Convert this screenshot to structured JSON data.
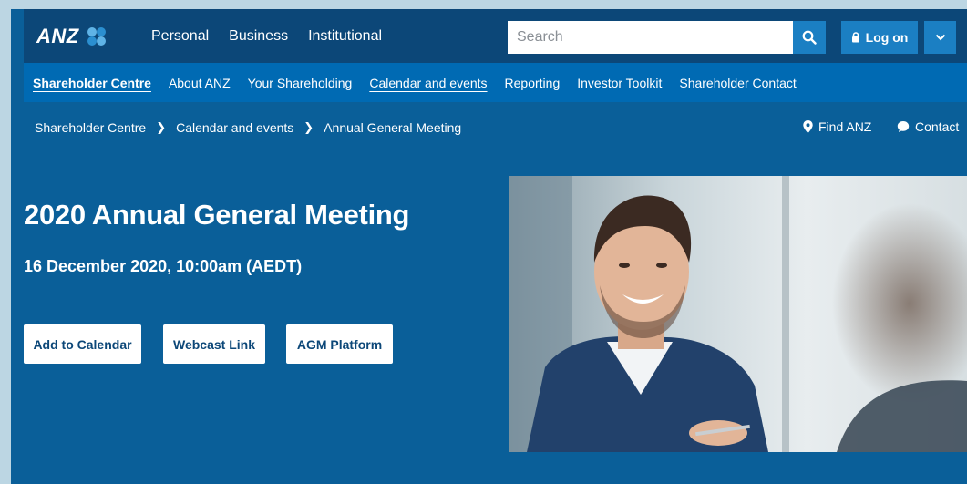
{
  "header": {
    "logo_text": "ANZ",
    "nav": [
      "Personal",
      "Business",
      "Institutional"
    ],
    "search_placeholder": "Search",
    "logon_label": "Log on"
  },
  "subnav": {
    "items": [
      "Shareholder Centre",
      "About ANZ",
      "Your Shareholding",
      "Calendar and events",
      "Reporting",
      "Investor Toolkit",
      "Shareholder Contact"
    ]
  },
  "breadcrumb": {
    "items": [
      "Shareholder Centre",
      "Calendar and events",
      "Annual General Meeting"
    ],
    "find_label": "Find ANZ",
    "contact_label": "Contact"
  },
  "hero": {
    "title": "2020 Annual General Meeting",
    "subtitle": "16 December 2020, 10:00am (AEDT)",
    "buttons": [
      "Add to Calendar",
      "Webcast Link",
      "AGM Platform"
    ]
  },
  "colors": {
    "brand_dark": "#0c4778",
    "brand": "#0a5f99",
    "accent": "#1b7fc3"
  }
}
